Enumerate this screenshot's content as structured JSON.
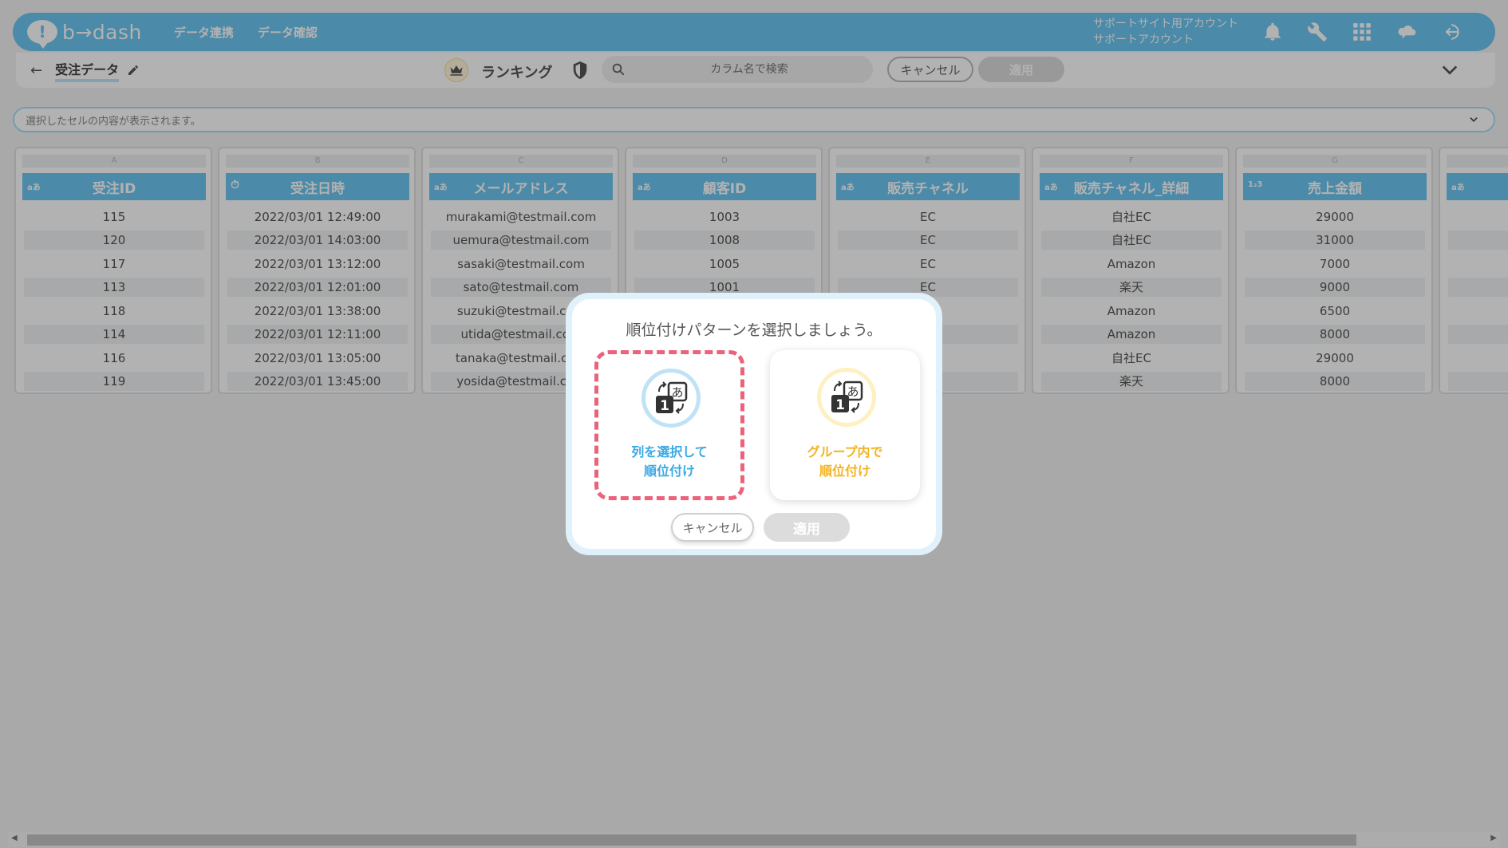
{
  "nav": {
    "logo_mark": "!",
    "logo": "b→dash",
    "links": [
      "データ連携",
      "データ確認"
    ],
    "account_line1": "サポートサイト用アカウント",
    "account_line2": "サポートアカウント",
    "icons": [
      "bell-icon",
      "wrench-icon",
      "grid-icon",
      "cloud-chat-icon",
      "logout-icon"
    ]
  },
  "toolbar": {
    "back": "←",
    "table_name": "受注データ",
    "ranking_label": "ランキング",
    "search_placeholder": "カラム名で検索",
    "cancel": "キャンセル",
    "apply": "適用"
  },
  "cell_bar": {
    "placeholder": "選択したセルの内容が表示されます。"
  },
  "table": {
    "columns": [
      {
        "letter": "A",
        "type": "aあ",
        "name": "受注ID",
        "cells": [
          "115",
          "120",
          "117",
          "113",
          "118",
          "114",
          "116",
          "119"
        ]
      },
      {
        "letter": "B",
        "type": "⏱",
        "name": "受注日時",
        "cells": [
          "2022/03/01 12:49:00",
          "2022/03/01 14:03:00",
          "2022/03/01 13:12:00",
          "2022/03/01 12:01:00",
          "2022/03/01 13:38:00",
          "2022/03/01 12:11:00",
          "2022/03/01 13:05:00",
          "2022/03/01 13:45:00"
        ]
      },
      {
        "letter": "C",
        "type": "aあ",
        "name": "メールアドレス",
        "cells": [
          "murakami@testmail.com",
          "uemura@testmail.com",
          "sasaki@testmail.com",
          "sato@testmail.com",
          "suzuki@testmail.com",
          "utida@testmail.com",
          "tanaka@testmail.com",
          "yosida@testmail.com"
        ]
      },
      {
        "letter": "D",
        "type": "aあ",
        "name": "顧客ID",
        "cells": [
          "1003",
          "1008",
          "1005",
          "1001",
          "",
          "",
          "",
          ""
        ]
      },
      {
        "letter": "E",
        "type": "aあ",
        "name": "販売チャネル",
        "cells": [
          "EC",
          "EC",
          "EC",
          "EC",
          "",
          "",
          "",
          ""
        ]
      },
      {
        "letter": "F",
        "type": "aあ",
        "name": "販売チャネル_詳細",
        "cells": [
          "自社EC",
          "自社EC",
          "Amazon",
          "楽天",
          "Amazon",
          "Amazon",
          "自社EC",
          "楽天"
        ]
      },
      {
        "letter": "G",
        "type": "1₂3",
        "name": "売上金額",
        "cells": [
          "29000",
          "31000",
          "7000",
          "9000",
          "6500",
          "8000",
          "29000",
          "8000"
        ]
      },
      {
        "letter": "",
        "type": "aあ",
        "name": "",
        "cells": [
          "",
          "",
          "",
          "",
          "",
          "",
          "",
          ""
        ]
      }
    ]
  },
  "modal": {
    "title": "順位付けパターンを選択しましょう。",
    "option_select": {
      "line1": "列を選択して",
      "line2": "順位付け"
    },
    "option_group": {
      "line1": "グループ内で",
      "line2": "順位付け"
    },
    "icon_num": "1",
    "icon_kana": "あ",
    "cancel": "キャンセル",
    "apply": "適用"
  },
  "colors": {
    "brand": "#6cc6f1",
    "select_dash": "#ec6279",
    "select_text": "#3ba9e6",
    "group_text": "#f3b323"
  }
}
